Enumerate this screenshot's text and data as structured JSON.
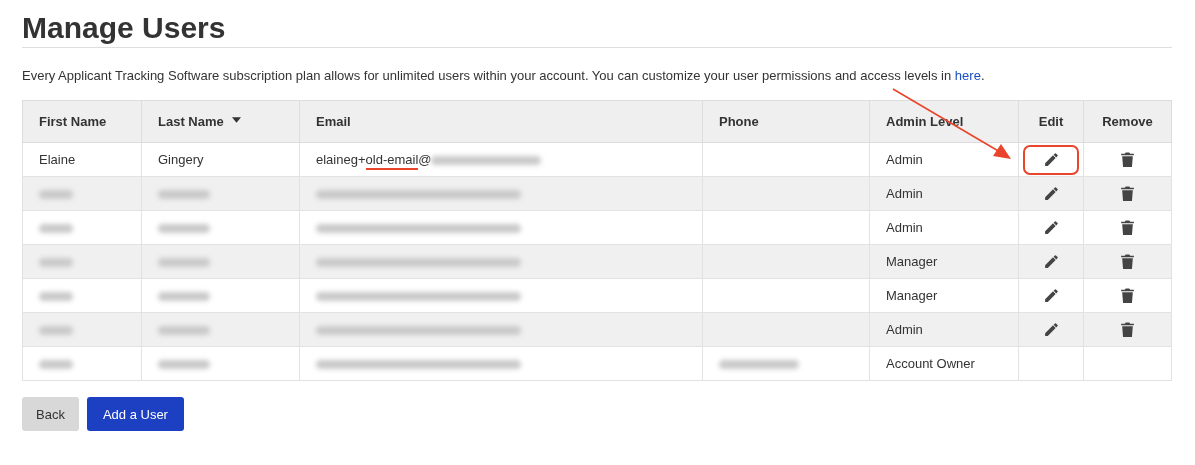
{
  "title": "Manage Users",
  "intro": {
    "text": "Every Applicant Tracking Software subscription plan allows for unlimited users within your account. You can customize your user permissions and access levels in ",
    "link": "here",
    "after": "."
  },
  "table": {
    "columns": [
      {
        "label": "First Name",
        "sorted": false
      },
      {
        "label": "Last Name",
        "sorted": true
      },
      {
        "label": "Email",
        "sorted": false
      },
      {
        "label": "Phone",
        "sorted": false
      },
      {
        "label": "Admin Level",
        "sorted": false
      },
      {
        "label": "Edit",
        "sorted": false
      },
      {
        "label": "Remove",
        "sorted": false
      }
    ],
    "rows": [
      {
        "first_name": {
          "text": "Elaine"
        },
        "last_name": {
          "text": "Gingery"
        },
        "email": {
          "parts": [
            {
              "text": "elaineg+"
            },
            {
              "text": "old-email",
              "marked": true
            },
            {
              "text": "@"
            }
          ],
          "blurred_tail": true
        },
        "phone": {
          "kind": "empty"
        },
        "admin_level": "Admin",
        "editable": true,
        "edit_highlighted": true,
        "removable": true
      },
      {
        "first_name": {
          "kind": "blurred"
        },
        "last_name": {
          "kind": "blurred"
        },
        "email": {
          "kind": "blurred"
        },
        "phone": {
          "kind": "empty"
        },
        "admin_level": "Admin",
        "editable": true,
        "removable": true
      },
      {
        "first_name": {
          "kind": "blurred"
        },
        "last_name": {
          "kind": "blurred"
        },
        "email": {
          "kind": "blurred"
        },
        "phone": {
          "kind": "empty"
        },
        "admin_level": "Admin",
        "editable": true,
        "removable": true
      },
      {
        "first_name": {
          "kind": "blurred"
        },
        "last_name": {
          "kind": "blurred"
        },
        "email": {
          "kind": "blurred"
        },
        "phone": {
          "kind": "empty"
        },
        "admin_level": "Manager",
        "editable": true,
        "removable": true
      },
      {
        "first_name": {
          "kind": "blurred"
        },
        "last_name": {
          "kind": "blurred"
        },
        "email": {
          "kind": "blurred"
        },
        "phone": {
          "kind": "empty"
        },
        "admin_level": "Manager",
        "editable": true,
        "removable": true
      },
      {
        "first_name": {
          "kind": "blurred"
        },
        "last_name": {
          "kind": "blurred"
        },
        "email": {
          "kind": "blurred"
        },
        "phone": {
          "kind": "empty"
        },
        "admin_level": "Admin",
        "editable": true,
        "removable": true
      },
      {
        "first_name": {
          "kind": "blurred"
        },
        "last_name": {
          "kind": "blurred"
        },
        "email": {
          "kind": "blurred"
        },
        "phone": {
          "kind": "blurred"
        },
        "admin_level": "Account Owner",
        "editable": false,
        "removable": false
      }
    ]
  },
  "buttons": [
    {
      "label": "Back",
      "kind": "secondary"
    },
    {
      "label": "Add a User",
      "kind": "primary"
    }
  ],
  "annotation_arrow": true
}
